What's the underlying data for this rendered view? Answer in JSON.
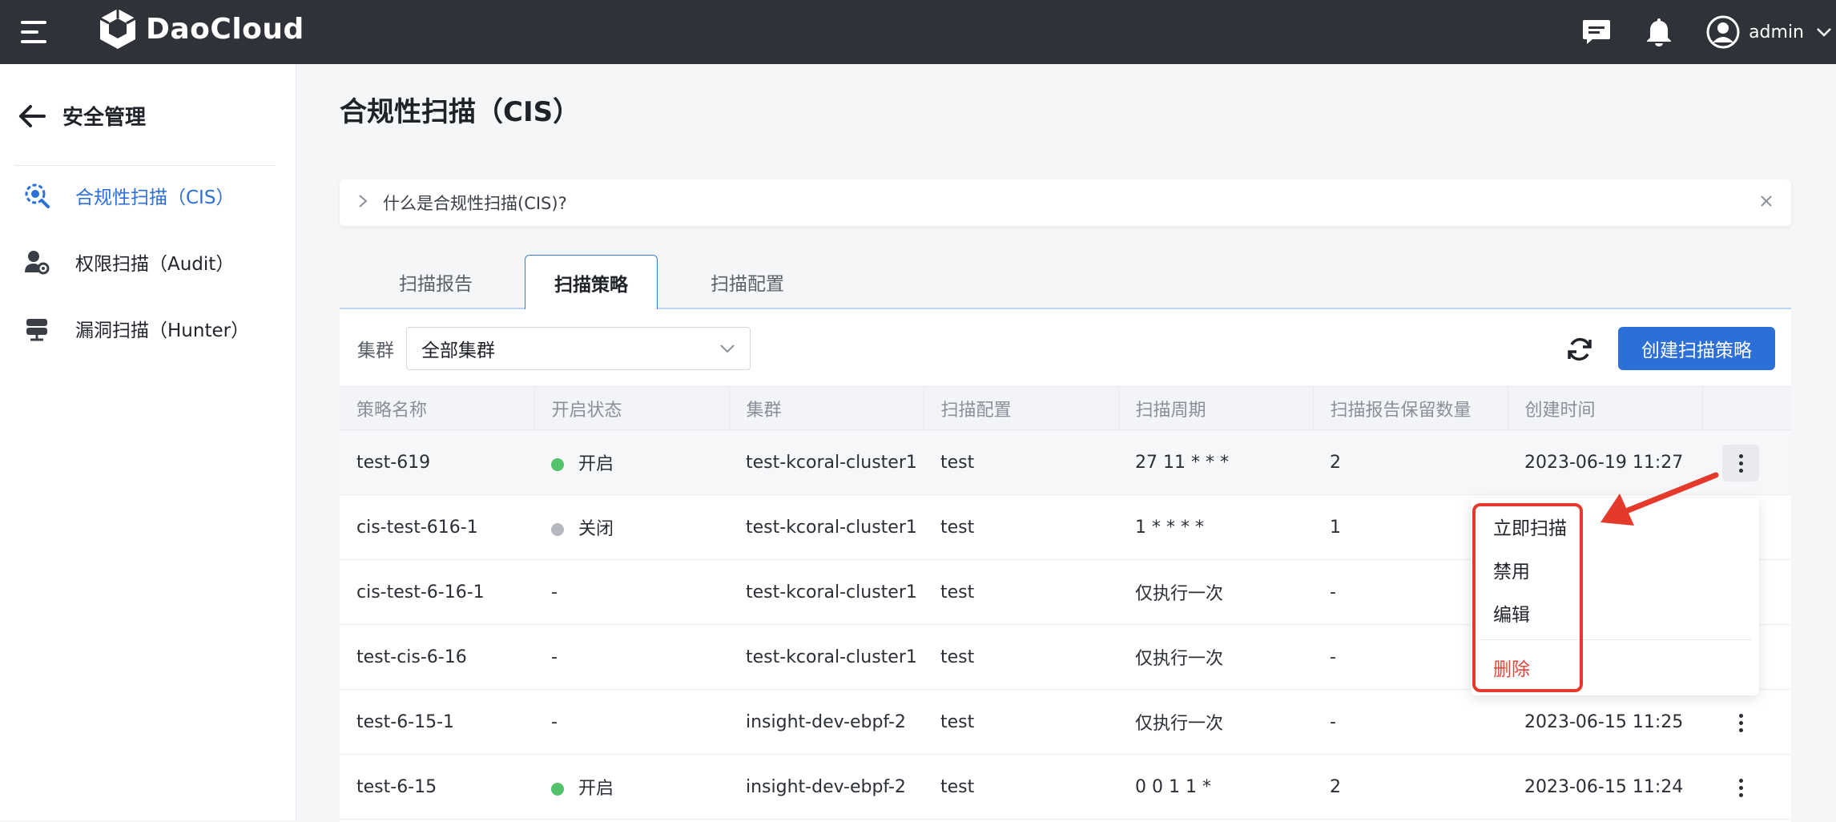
{
  "topbar": {
    "brand": "DaoCloud",
    "user": "admin"
  },
  "sidebar": {
    "back_title": "安全管理",
    "items": [
      {
        "label": "合规性扫描（CIS）",
        "icon": "compliance-scan-icon",
        "active": true
      },
      {
        "label": "权限扫描（Audit）",
        "icon": "user-gear-icon",
        "active": false
      },
      {
        "label": "漏洞扫描（Hunter）",
        "icon": "server-icon",
        "active": false
      }
    ]
  },
  "main": {
    "title": "合规性扫描（CIS）",
    "info": "什么是合规性扫描(CIS)?",
    "tabs": [
      {
        "label": "扫描报告",
        "active": false
      },
      {
        "label": "扫描策略",
        "active": true
      },
      {
        "label": "扫描配置",
        "active": false
      }
    ],
    "filter": {
      "label": "集群",
      "value": "全部集群"
    },
    "create_button": "创建扫描策略"
  },
  "table": {
    "columns": [
      "策略名称",
      "开启状态",
      "集群",
      "扫描配置",
      "扫描周期",
      "扫描报告保留数量",
      "创建时间"
    ],
    "rows": [
      {
        "name": "test-619",
        "status": "开启",
        "cluster": "test-kcoral-cluster1",
        "config": "test",
        "cycle": "27 11 * * *",
        "retain": "2",
        "created": "2023-06-19 11:27"
      },
      {
        "name": "cis-test-616-1",
        "status": "关闭",
        "cluster": "test-kcoral-cluster1",
        "config": "test",
        "cycle": "1 * * * *",
        "retain": "1",
        "created": ""
      },
      {
        "name": "cis-test-6-16-1",
        "status": "-",
        "cluster": "test-kcoral-cluster1",
        "config": "test",
        "cycle": "仅执行一次",
        "retain": "-",
        "created": ""
      },
      {
        "name": "test-cis-6-16",
        "status": "-",
        "cluster": "test-kcoral-cluster1",
        "config": "test",
        "cycle": "仅执行一次",
        "retain": "-",
        "created": ""
      },
      {
        "name": "test-6-15-1",
        "status": "-",
        "cluster": "insight-dev-ebpf-2",
        "config": "test",
        "cycle": "仅执行一次",
        "retain": "-",
        "created": "2023-06-15 11:25"
      },
      {
        "name": "test-6-15",
        "status": "开启",
        "cluster": "insight-dev-ebpf-2",
        "config": "test",
        "cycle": "0 0 1 1 *",
        "retain": "2",
        "created": "2023-06-15 11:24"
      }
    ]
  },
  "menu": {
    "items": [
      "立即扫描",
      "禁用",
      "编辑",
      "删除"
    ]
  },
  "colors": {
    "topbar": "#2f3238",
    "primary": "#2c6fd6",
    "status_on": "#52c26b",
    "status_off": "#b5b8bf",
    "danger": "#e2463c",
    "annotation": "#e53a2b"
  }
}
